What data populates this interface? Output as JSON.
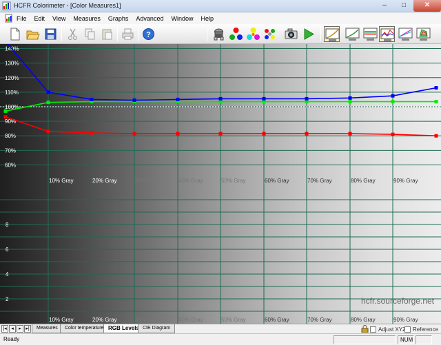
{
  "window": {
    "title": "HCFR Colorimeter - [Color Measures1]",
    "minimize": "–",
    "maximize": "□",
    "close": "✕"
  },
  "menu": [
    "File",
    "Edit",
    "View",
    "Measures",
    "Graphs",
    "Advanced",
    "Window",
    "Help"
  ],
  "toolbar_icons": [
    "new-document-icon",
    "open-folder-icon",
    "save-icon",
    "cut-icon",
    "copy-icon",
    "paste-icon",
    "print-icon",
    "help-icon",
    "sensor-icon",
    "rgb-primaries-icon",
    "secondaries-icon",
    "full-measure-icon",
    "camera-icon",
    "play-icon",
    "gamma-graph-icon",
    "luminance-graph-icon",
    "rgb-levels-graph-icon",
    "color-temp-graph-icon",
    "saturation-graph-icon",
    "cie-graph-icon"
  ],
  "colors": {
    "red_series": "#ff0000",
    "green_series": "#00ee00",
    "blue_series": "#0000ff",
    "grid": "#1f6b55",
    "reference_line": "#ffffff"
  },
  "chart_data": [
    {
      "type": "line",
      "y_tick_labels": [
        "140%",
        "130%",
        "120%",
        "110%",
        "100%",
        "90%",
        "80%",
        "70%",
        "60%"
      ],
      "ylim": [
        55,
        145
      ],
      "x_tick_labels": [
        "10% Gray",
        "20% Gray",
        "30% Gray",
        "40% Gray",
        "50% Gray",
        "60% Gray",
        "70% Gray",
        "80% Gray",
        "90% Gray"
      ],
      "x": [
        0,
        10,
        20,
        30,
        40,
        50,
        60,
        70,
        80,
        90,
        100
      ],
      "grid": true,
      "reference_value": 100,
      "series": [
        {
          "color": "red",
          "values": [
            93,
            83,
            82,
            81.5,
            81.5,
            81.5,
            81.5,
            81.5,
            81.5,
            81,
            80
          ]
        },
        {
          "color": "green",
          "values": [
            97,
            103,
            103.5,
            103.5,
            103.5,
            103.5,
            103.5,
            103.5,
            103.5,
            103.5,
            103.5
          ]
        },
        {
          "color": "blue",
          "values": [
            145,
            110,
            105,
            104.5,
            105,
            105.5,
            105.5,
            105.5,
            106,
            107.5,
            113
          ]
        }
      ]
    },
    {
      "type": "line",
      "y_tick_labels": [
        "8",
        "6",
        "4",
        "2"
      ],
      "ylim": [
        0,
        10
      ],
      "x_tick_labels": [
        "10% Gray",
        "20% Gray",
        "30% Gray",
        "40% Gray",
        "50% Gray",
        "60% Gray",
        "70% Gray",
        "80% Gray",
        "90% Gray"
      ],
      "grid": true,
      "series": []
    }
  ],
  "watermark": "hcfr.sourceforge.net",
  "tabs": [
    "Measures",
    "Color temperature",
    "RGB Levels",
    "CIE Diagram"
  ],
  "active_tab": "RGB Levels",
  "nav_buttons": [
    "|◂",
    "◂",
    "▸",
    "▸|"
  ],
  "adjust_xyz": {
    "label": "Adjust XYZ",
    "checked": false
  },
  "reference": {
    "label": "Reference",
    "checked": false
  },
  "status": {
    "text": "Ready",
    "num": "NUM"
  }
}
